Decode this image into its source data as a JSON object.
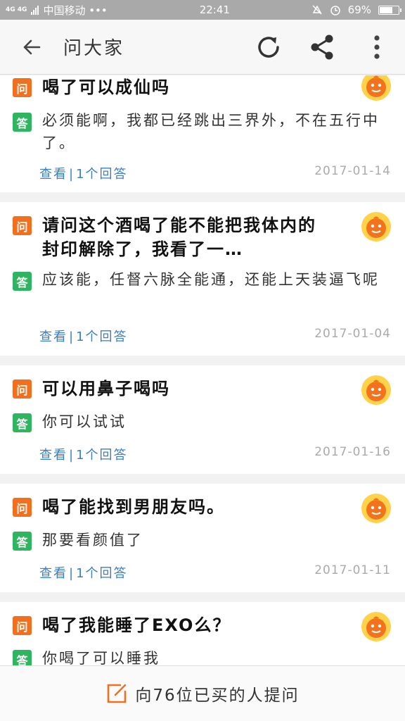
{
  "status_bar": {
    "network_tag": "4G 4G",
    "carrier": "中国移动 •••",
    "time": "22:41",
    "battery": "69%",
    "battery_fraction": 0.69
  },
  "header": {
    "title": "问大家",
    "back_icon": "arrow-left-icon",
    "refresh_icon": "refresh-icon",
    "share_icon": "share-icon",
    "more_icon": "more-vertical-icon"
  },
  "colors": {
    "question_badge": "#f0701f",
    "answer_badge": "#2fb55f",
    "link": "#3a7fc2",
    "edit_icon": "#f0701f"
  },
  "badges": {
    "question": "问",
    "answer": "答"
  },
  "cards": [
    {
      "question": "喝了可以成仙吗",
      "answer": "必须能啊，我都已经跳出三界外，不在五行中了。",
      "view": "查看",
      "answers": "1个回答",
      "date": "2017-01-14"
    },
    {
      "question": "请问这个酒喝了能不能把我体内的封印解除了，我看了一…",
      "answer": "应该能，任督六脉全能通，还能上天装逼飞呢",
      "view": "查看",
      "answers": "1个回答",
      "date": "2017-01-04"
    },
    {
      "question": "可以用鼻子喝吗",
      "answer": "你可以试试",
      "view": "查看",
      "answers": "1个回答",
      "date": "2017-01-16"
    },
    {
      "question": "喝了能找到男朋友吗。",
      "answer": "那要看颜值了",
      "view": "查看",
      "answers": "1个回答",
      "date": "2017-01-11"
    },
    {
      "question": "喝了我能睡了EXO么？",
      "answer": "你喝了可以睡我",
      "view": "",
      "answers": "",
      "date": ""
    }
  ],
  "bottom": {
    "label": "向76位已买的人提问",
    "icon": "edit-icon"
  }
}
